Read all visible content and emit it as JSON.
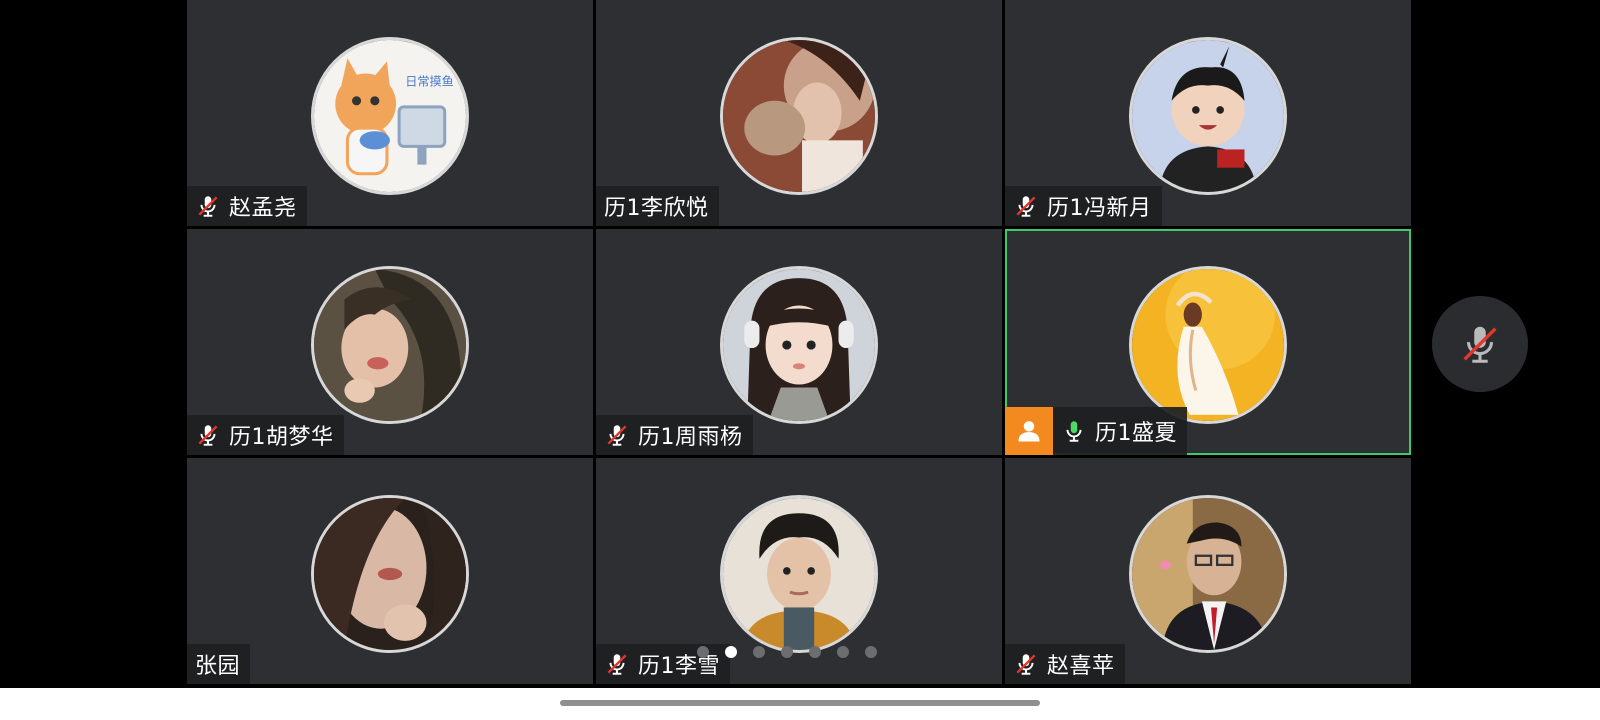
{
  "participants": [
    {
      "name": "赵孟尧",
      "mic": "muted",
      "avatar": "cat-cartoon-avatar"
    },
    {
      "name": "历1李欣悦",
      "mic": "none",
      "avatar": "girl-with-cat-photo-avatar"
    },
    {
      "name": "历1冯新月",
      "mic": "muted",
      "avatar": "child-photo-avatar"
    },
    {
      "name": "历1胡梦华",
      "mic": "muted",
      "avatar": "girl-photo-avatar"
    },
    {
      "name": "历1周雨杨",
      "mic": "muted",
      "avatar": "girl-headphones-photo-avatar"
    },
    {
      "name": "历1盛夏",
      "mic": "on",
      "avatar": "yellow-illustration-avatar",
      "host": true,
      "active": true
    },
    {
      "name": "张园",
      "mic": "none",
      "avatar": "woman-closeup-photo-avatar"
    },
    {
      "name": "历1李雪",
      "mic": "muted",
      "avatar": "young-man-photo-avatar"
    },
    {
      "name": "赵喜苹",
      "mic": "muted",
      "avatar": "man-in-suit-photo-avatar"
    }
  ],
  "pagination": {
    "total": 7,
    "current": 2
  },
  "self_mic": {
    "state": "muted"
  },
  "colors": {
    "active_border": "#3cc86b",
    "host_badge": "#f38a1f",
    "mic_on": "#4cd964",
    "mute_slash": "#e2372d"
  }
}
